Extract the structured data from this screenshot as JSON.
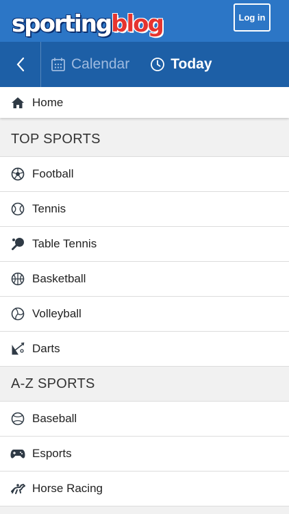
{
  "header": {
    "logo_part1": "sporting",
    "logo_part2": "blog",
    "login_label": "Log in"
  },
  "nav": {
    "calendar_label": "Calendar",
    "today_label": "Today"
  },
  "home": {
    "label": "Home",
    "icon": "home-icon"
  },
  "top_sports": {
    "title": "TOP SPORTS",
    "items": [
      {
        "label": "Football",
        "icon": "football-icon"
      },
      {
        "label": "Tennis",
        "icon": "tennis-icon"
      },
      {
        "label": "Table Tennis",
        "icon": "table-tennis-icon"
      },
      {
        "label": "Basketball",
        "icon": "basketball-icon"
      },
      {
        "label": "Volleyball",
        "icon": "volleyball-icon"
      },
      {
        "label": "Darts",
        "icon": "darts-icon"
      }
    ]
  },
  "az_sports": {
    "title": "A-Z SPORTS",
    "items": [
      {
        "label": "Baseball",
        "icon": "baseball-icon"
      },
      {
        "label": "Esports",
        "icon": "gamepad-icon"
      },
      {
        "label": "Horse Racing",
        "icon": "horse-racing-icon"
      }
    ]
  },
  "colors": {
    "topbar": "#2c76c6",
    "navbar": "#1d5fa6",
    "logo_red": "#e5342f"
  }
}
